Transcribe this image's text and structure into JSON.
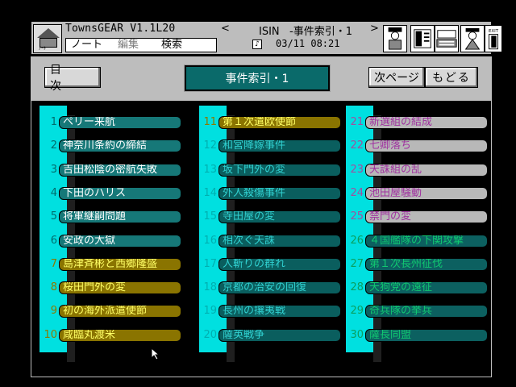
{
  "app": {
    "title": "TownsGEAR V1.1L20",
    "window_index_label": "ISIN   -事件索引・1",
    "prev_arrow": "<",
    "next_arrow": ">",
    "menu": {
      "note": "ノート",
      "edit": "編集",
      "search": "検索"
    },
    "datetime": "03/11 08:21",
    "icon_label": "ﾉｰﾄ",
    "speaker_glyph": "♪",
    "exit_label": "EXIT"
  },
  "header": {
    "contents_button": "目次",
    "title": "事件索引・1",
    "next_page_button": "次ページ",
    "back_button": "もどる"
  },
  "columns": [
    {
      "items": [
        {
          "num": "1",
          "label": "ペリー来航",
          "style": "cyan"
        },
        {
          "num": "2",
          "label": "神奈川条約の締結",
          "style": "cyan"
        },
        {
          "num": "3",
          "label": "吉田松陰の密航失敗",
          "style": "cyan"
        },
        {
          "num": "4",
          "label": "下田のハリス",
          "style": "cyan"
        },
        {
          "num": "5",
          "label": "将軍継嗣問題",
          "style": "cyan"
        },
        {
          "num": "6",
          "label": "安政の大獄",
          "style": "cyan"
        },
        {
          "num": "7",
          "label": "島津斉彬と西郷隆盛",
          "style": "yellow"
        },
        {
          "num": "8",
          "label": "桜田門外の変",
          "style": "yellow"
        },
        {
          "num": "9",
          "label": "初の海外派遣使節",
          "style": "yellow"
        },
        {
          "num": "10",
          "label": "咸臨丸渡米",
          "style": "yellow"
        }
      ]
    },
    {
      "items": [
        {
          "num": "11",
          "label": "第１次遣欧使節",
          "style": "yellow"
        },
        {
          "num": "12",
          "label": "和宮降嫁事件",
          "style": "teal"
        },
        {
          "num": "13",
          "label": "坂下門外の変",
          "style": "teal"
        },
        {
          "num": "14",
          "label": "外人殺傷事件",
          "style": "teal"
        },
        {
          "num": "15",
          "label": "寺田屋の変",
          "style": "teal"
        },
        {
          "num": "16",
          "label": "相次ぐ天誅",
          "style": "teal"
        },
        {
          "num": "17",
          "label": "人斬りの群れ",
          "style": "teal"
        },
        {
          "num": "18",
          "label": "京都の治安の回復",
          "style": "teal"
        },
        {
          "num": "19",
          "label": "長州の攘夷戦",
          "style": "teal"
        },
        {
          "num": "20",
          "label": "薩英戦争",
          "style": "teal"
        }
      ]
    },
    {
      "items": [
        {
          "num": "21",
          "label": "新選組の結成",
          "style": "grey"
        },
        {
          "num": "22",
          "label": "七卿落ち",
          "style": "grey"
        },
        {
          "num": "23",
          "label": "天誅組の乱",
          "style": "grey"
        },
        {
          "num": "24",
          "label": "池田屋騒動",
          "style": "grey"
        },
        {
          "num": "25",
          "label": "禁門の変",
          "style": "grey"
        },
        {
          "num": "26",
          "label": "４国艦隊の下関攻撃",
          "style": "green"
        },
        {
          "num": "27",
          "label": "第１次長州征伐",
          "style": "green"
        },
        {
          "num": "28",
          "label": "天狗党の遠征",
          "style": "green"
        },
        {
          "num": "29",
          "label": "奇兵隊の挙兵",
          "style": "green"
        },
        {
          "num": "30",
          "label": "薩長同盟",
          "style": "green"
        }
      ]
    }
  ]
}
